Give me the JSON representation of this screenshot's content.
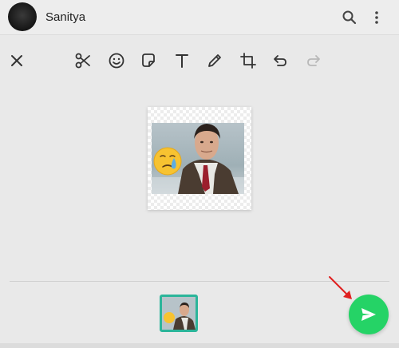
{
  "chat": {
    "contact_name": "Sanitya"
  },
  "header": {
    "icons": [
      "search-icon",
      "more-vertical-icon"
    ]
  },
  "editor_toolbar": {
    "icons": [
      "close-icon",
      "scissors-icon",
      "emoji-icon",
      "sticker-icon",
      "text-icon",
      "pencil-icon",
      "crop-rotate-icon",
      "undo-icon",
      "redo-icon"
    ],
    "redo_enabled": false
  },
  "colors": {
    "accent": "#25d366",
    "thumbnail_border": "#2bb59a",
    "annotation_arrow": "#e02020"
  }
}
